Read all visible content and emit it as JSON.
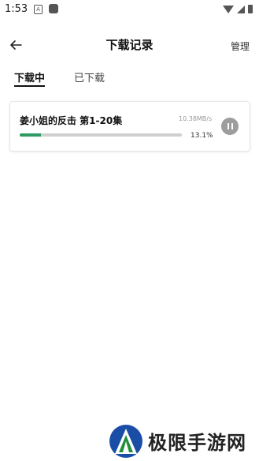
{
  "status_bar": {
    "time": "1:53",
    "notification_icon": "A"
  },
  "header": {
    "title": "下载记录",
    "manage_label": "管理"
  },
  "tabs": {
    "downloading_label": "下载中",
    "downloaded_label": "已下载",
    "active": "downloading"
  },
  "downloads": [
    {
      "title": "姜小姐的反击 第1-20集",
      "speed": "10.38MB/s",
      "progress_percent": 13.1,
      "progress_text": "13.1%"
    }
  ],
  "watermark": {
    "text": "极限手游网"
  },
  "colors": {
    "progress_fill": "#2c9b63",
    "progress_track": "#cfcfcf",
    "pause_button": "#9d9d9d",
    "logo_blue": "#1a4ea6",
    "logo_green": "#1f8f3a"
  }
}
